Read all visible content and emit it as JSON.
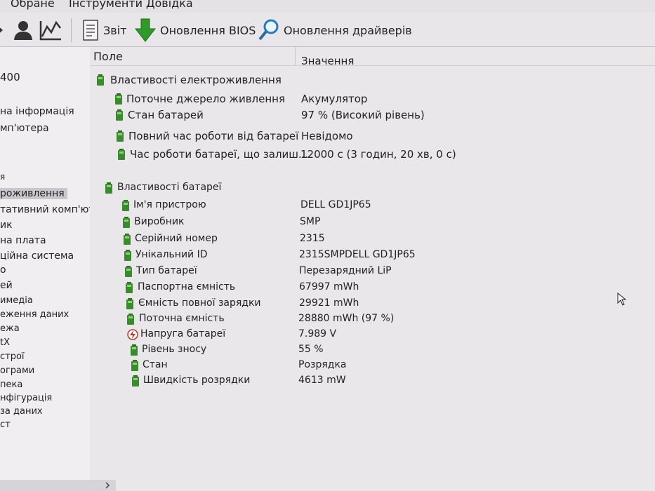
{
  "menu": {
    "items": [
      "Обране",
      "Інструменти",
      "Довідка"
    ]
  },
  "toolbar": {
    "report": "Звіт",
    "bios_update": "Оновлення BIOS",
    "driver_update": "Оновлення драйверів"
  },
  "sidebar": {
    "items": [
      "400",
      "на інформація",
      "мп'ютера",
      "я",
      "роживлення",
      "тативний комп'юте",
      "ик",
      "на плата",
      "ційна система",
      "о",
      "ей",
      "имедіа",
      "еження даних",
      "ежа",
      "tX",
      "строї",
      "ограми",
      "пека",
      "нфігурація",
      "за даних",
      "ст"
    ],
    "selected": "роживлення"
  },
  "table": {
    "header": {
      "field": "Поле",
      "value": "Значення"
    },
    "groups": [
      {
        "title": "Властивості електроживлення",
        "rows": [
          {
            "field": "Поточне джерело живлення",
            "value": "Акумулятор"
          },
          {
            "field": "Стан батарей",
            "value": "97 % (Високий рівень)"
          },
          {
            "field": "Повний час роботи від батареї",
            "value": "Невідомо"
          },
          {
            "field": "Час роботи батареї, що залиш...",
            "value": "12000 с (3 годин, 20 хв, 0 с)"
          }
        ]
      },
      {
        "title": "Властивості батареї",
        "rows": [
          {
            "field": "Ім'я пристрою",
            "value": "DELL GD1JP65"
          },
          {
            "field": "Виробник",
            "value": "SMP"
          },
          {
            "field": "Серійний номер",
            "value": "2315"
          },
          {
            "field": "Унікальний ID",
            "value": "2315SMPDELL GD1JP65"
          },
          {
            "field": "Тип батареї",
            "value": "Перезарядний LiP"
          },
          {
            "field": "Паспортна ємність",
            "value": "67997 mWh"
          },
          {
            "field": "Ємність повної зарядки",
            "value": "29921 mWh"
          },
          {
            "field": "Поточна ємність",
            "value": "28880 mWh  (97 %)"
          },
          {
            "field": "Напруга батареї",
            "value": "7.989 V"
          },
          {
            "field": "Рівень зносу",
            "value": "55 %"
          },
          {
            "field": "Стан",
            "value": "Розрядка"
          },
          {
            "field": "Швидкість розрядки",
            "value": "4613 mW"
          }
        ]
      }
    ]
  },
  "colors": {
    "battery_icon": "#3a8a2e",
    "arrow_icon": "#2f9a2a",
    "voltage_icon": "#c0392b"
  }
}
